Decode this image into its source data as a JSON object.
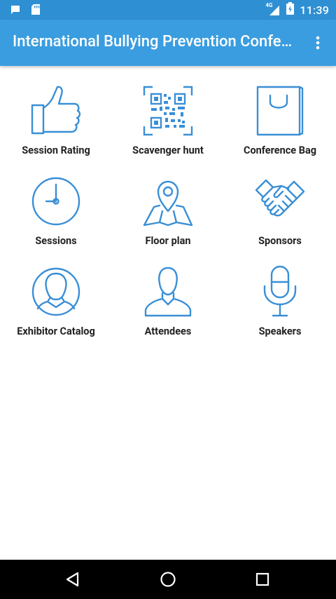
{
  "status_bar": {
    "time": "11:39",
    "network": "4G",
    "icons": [
      "message-icon",
      "sd-card-icon",
      "signal-icon",
      "battery-icon"
    ]
  },
  "app_bar": {
    "title": "International Bullying Prevention Conference",
    "menu_icon": "more-vert-icon"
  },
  "colors": {
    "status_bar": "#2f8fd3",
    "app_bar": "#3a9de0",
    "icon_stroke": "#3a8fd6",
    "label_text": "#222222",
    "nav_bar": "#000000"
  },
  "tiles": [
    {
      "label": "Session Rating",
      "icon": "thumbs-up-icon"
    },
    {
      "label": "Scavenger hunt",
      "icon": "qr-code-icon"
    },
    {
      "label": "Conference Bag",
      "icon": "shopping-bag-icon"
    },
    {
      "label": "Sessions",
      "icon": "clock-icon"
    },
    {
      "label": "Floor plan",
      "icon": "map-pin-icon"
    },
    {
      "label": "Sponsors",
      "icon": "handshake-icon"
    },
    {
      "label": "Exhibitor Catalog",
      "icon": "person-circle-icon"
    },
    {
      "label": "Attendees",
      "icon": "person-icon"
    },
    {
      "label": "Speakers",
      "icon": "microphone-icon"
    }
  ],
  "nav": {
    "items": [
      "back-icon",
      "home-icon",
      "recents-icon"
    ]
  }
}
